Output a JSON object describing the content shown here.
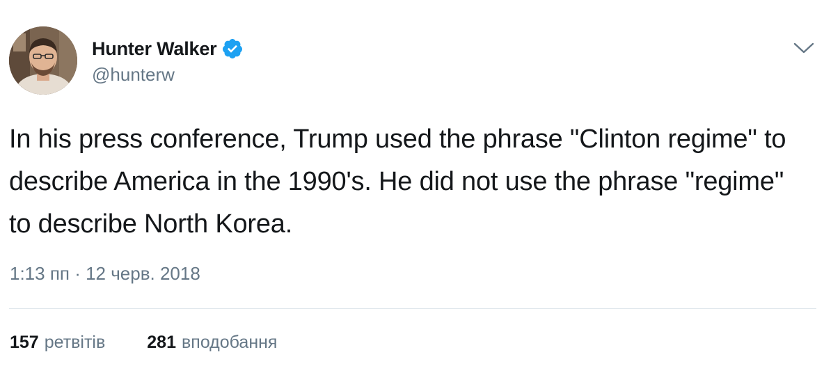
{
  "tweet": {
    "author": {
      "display_name": "Hunter Walker",
      "handle": "@hunterw",
      "verified": true
    },
    "text": "In his press conference, Trump used the phrase \"Clinton regime\" to describe America in the 1990's. He did not use the phrase \"regime\" to describe North Korea.",
    "timestamp": "1:13 пп · 12 черв. 2018",
    "stats": {
      "retweets_count": "157",
      "retweets_label": "ретвітів",
      "likes_count": "281",
      "likes_label": "вподобання"
    }
  },
  "icons": {
    "verified": "verified-badge-icon",
    "caret": "chevron-down-icon"
  },
  "colors": {
    "text_primary": "#14171a",
    "text_secondary": "#657786",
    "verified_blue": "#1da1f2",
    "divider": "#e1e8ed"
  }
}
